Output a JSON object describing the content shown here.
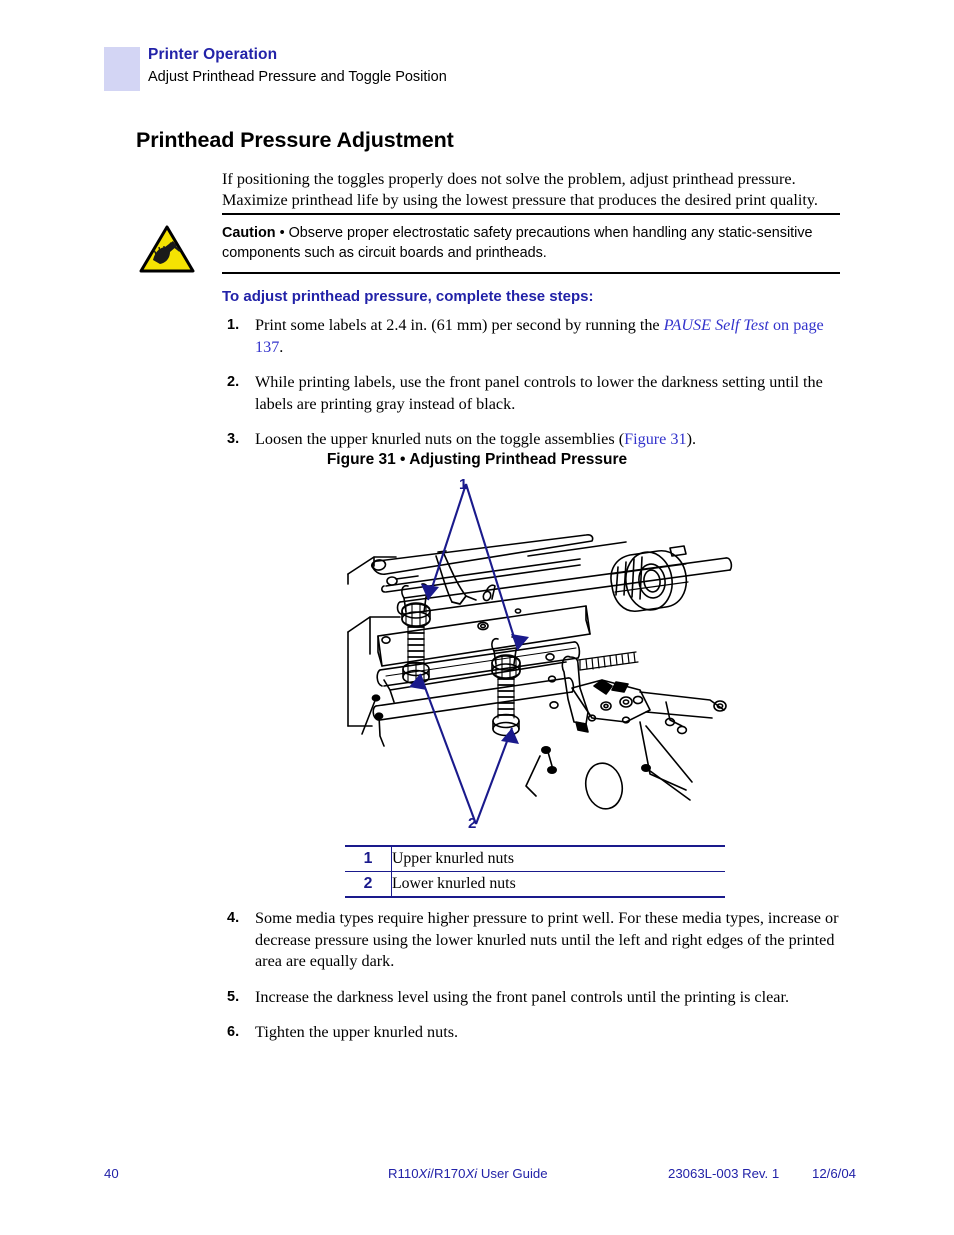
{
  "header": {
    "chapter": "Printer Operation",
    "section": "Adjust Printhead Pressure and Toggle Position",
    "swatch_color": "#d3d5f4",
    "accent_color": "#2222a8"
  },
  "title": "Printhead Pressure Adjustment",
  "intro": "If positioning the toggles properly does not solve the problem, adjust printhead pressure. Maximize printhead life by using the lowest pressure that produces the desired print quality.",
  "caution": {
    "icon": "esd-warning-triangle-icon",
    "label": "Caution",
    "separator": "•",
    "text": "Observe proper electrostatic safety precautions when handling any static-sensitive components such as circuit boards and printheads.",
    "icon_fill": "#f5e302",
    "icon_stroke": "#000000"
  },
  "procedure": {
    "heading": "To adjust printhead pressure, complete these steps:",
    "steps_upper": [
      {
        "num": "1.",
        "parts": [
          {
            "text": "Print some labels at 2.4 in. (61 mm) per second by running the ",
            "style": "plain"
          },
          {
            "text": "PAUSE Self Test",
            "style": "xref-italic"
          },
          {
            "text": " ",
            "style": "plain"
          },
          {
            "text": "on page 137",
            "style": "xref"
          },
          {
            "text": ".",
            "style": "plain"
          }
        ]
      },
      {
        "num": "2.",
        "parts": [
          {
            "text": "While printing labels, use the front panel controls to lower the darkness setting until the labels are printing gray instead of black.",
            "style": "plain"
          }
        ]
      },
      {
        "num": "3.",
        "parts": [
          {
            "text": "Loosen the upper knurled nuts on the toggle assemblies (",
            "style": "plain"
          },
          {
            "text": "Figure 31",
            "style": "xref"
          },
          {
            "text": ").",
            "style": "plain"
          }
        ]
      }
    ],
    "steps_lower": [
      {
        "num": "4.",
        "parts": [
          {
            "text": "Some media types require higher pressure to print well. For these media types, increase or decrease pressure using the lower knurled nuts until the left and right edges of the printed area are equally dark.",
            "style": "plain"
          }
        ]
      },
      {
        "num": "5.",
        "parts": [
          {
            "text": "Increase the darkness level using the front panel controls until the printing is clear.",
            "style": "plain"
          }
        ]
      },
      {
        "num": "6.",
        "parts": [
          {
            "text": "Tighten the upper knurled nuts.",
            "style": "plain"
          }
        ]
      }
    ]
  },
  "figure": {
    "caption": "Figure 31 • Adjusting Printhead Pressure",
    "callouts": [
      {
        "id": "1",
        "label": "1"
      },
      {
        "id": "2",
        "label": "2"
      }
    ],
    "legend": [
      {
        "num": "1",
        "text": "Upper knurled nuts"
      },
      {
        "num": "2",
        "text": "Lower knurled nuts"
      }
    ],
    "callout_color": "#1a1a8c",
    "line_color": "#000000"
  },
  "footer": {
    "page_number": "40",
    "guide_prefix": "R110",
    "guide_model_a": "Xi",
    "guide_mid": "/R170",
    "guide_model_b": "Xi",
    "guide_suffix": " User Guide",
    "doc_number": "23063L-003 Rev. 1",
    "date": "12/6/04",
    "color": "#2222a8"
  }
}
